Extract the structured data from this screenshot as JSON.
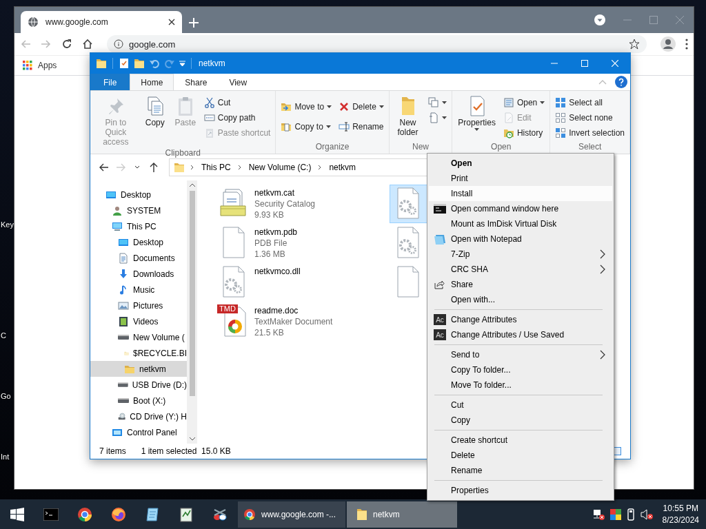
{
  "desktop": {
    "icon_labels": [
      "Key",
      "C",
      "Go",
      "Int"
    ]
  },
  "browser": {
    "tabs": [
      {
        "title": "www.google.com",
        "selected": true
      }
    ],
    "address": "google.com",
    "bookmarks": [
      {
        "label": "Apps",
        "kind": "apps"
      }
    ]
  },
  "explorer": {
    "title": "netkvm",
    "ribbon_tabs": [
      {
        "label": "File",
        "kind": "file",
        "selected": false
      },
      {
        "label": "Home",
        "kind": "tab",
        "selected": true
      },
      {
        "label": "Share",
        "kind": "tab",
        "selected": false
      },
      {
        "label": "View",
        "kind": "tab",
        "selected": false
      }
    ],
    "ribbon_groups": [
      {
        "label": "Clipboard",
        "columns": [
          [
            {
              "label": "Pin to Quick access",
              "kind": "large",
              "dropdown": false,
              "disabled": true
            }
          ],
          [
            {
              "label": "Copy",
              "kind": "large",
              "dropdown": false,
              "disabled": false
            }
          ],
          [
            {
              "label": "Paste",
              "kind": "large",
              "dropdown": false,
              "disabled": true
            }
          ],
          [
            {
              "label": "Cut",
              "kind": "small",
              "dropdown": false,
              "disabled": false
            },
            {
              "label": "Copy path",
              "kind": "small",
              "dropdown": false,
              "disabled": false
            },
            {
              "label": "Paste shortcut",
              "kind": "small",
              "dropdown": false,
              "disabled": true
            }
          ]
        ]
      },
      {
        "label": "Organize",
        "columns": [
          [
            {
              "label": "Move to",
              "kind": "small",
              "dropdown": true,
              "disabled": false
            },
            {
              "label": "Copy to",
              "kind": "small",
              "dropdown": true,
              "disabled": false
            }
          ],
          [
            {
              "label": "Delete",
              "kind": "small",
              "dropdown": true,
              "disabled": false
            },
            {
              "label": "Rename",
              "kind": "small",
              "dropdown": false,
              "disabled": false
            }
          ]
        ]
      },
      {
        "label": "New",
        "columns": [
          [
            {
              "label": "New folder",
              "kind": "large",
              "dropdown": false,
              "disabled": false
            }
          ],
          [
            {
              "kind": "small",
              "dropdown": true,
              "disabled": false
            },
            {
              "kind": "small",
              "dropdown": true,
              "disabled": false
            }
          ]
        ]
      },
      {
        "label": "Open",
        "columns": [
          [
            {
              "label": "Properties",
              "kind": "large",
              "dropdown": true,
              "disabled": false
            }
          ],
          [
            {
              "label": "Open",
              "kind": "small",
              "dropdown": true,
              "disabled": false
            },
            {
              "label": "Edit",
              "kind": "small",
              "dropdown": false,
              "disabled": true
            },
            {
              "label": "History",
              "kind": "small",
              "dropdown": false,
              "disabled": false
            }
          ]
        ]
      },
      {
        "label": "Select",
        "columns": [
          [
            {
              "label": "Select all",
              "kind": "small",
              "dropdown": false,
              "disabled": false
            },
            {
              "label": "Select none",
              "kind": "small",
              "dropdown": false,
              "disabled": false
            },
            {
              "label": "Invert selection",
              "kind": "small",
              "dropdown": false,
              "disabled": false
            }
          ]
        ]
      }
    ],
    "nav_buttons": [
      {
        "kind": "back",
        "disabled": false
      },
      {
        "kind": "forward",
        "disabled": true
      },
      {
        "kind": "recent",
        "disabled": false
      },
      {
        "kind": "up",
        "disabled": false
      }
    ],
    "breadcrumb": [
      "This PC",
      "New Volume (C:)",
      "netkvm"
    ],
    "nav_tree": [
      {
        "label": "Desktop",
        "selected": false,
        "children": [
          {
            "label": "SYSTEM",
            "selected": false
          },
          {
            "label": "This PC",
            "selected": false,
            "children": [
              {
                "label": "Desktop",
                "selected": false
              },
              {
                "label": "Documents",
                "selected": false
              },
              {
                "label": "Downloads",
                "selected": false
              },
              {
                "label": "Music",
                "selected": false
              },
              {
                "label": "Pictures",
                "selected": false
              },
              {
                "label": "Videos",
                "selected": false
              },
              {
                "label": "New Volume (",
                "selected": false,
                "children": [
                  {
                    "label": "$RECYCLE.BI",
                    "selected": false
                  },
                  {
                    "label": "netkvm",
                    "selected": true
                  }
                ]
              },
              {
                "label": "USB Drive (D:)",
                "selected": false
              },
              {
                "label": "Boot (X:)",
                "selected": false
              },
              {
                "label": "CD Drive (Y:) H",
                "selected": false
              }
            ]
          },
          {
            "label": "Control Panel",
            "selected": false
          }
        ]
      }
    ],
    "files": [
      {
        "name": "netkvm.cat",
        "type": "Security Catalog",
        "size": "9.93 KB",
        "selected": false
      },
      {
        "name": "netkvm.pdb",
        "type": "PDB File",
        "size": "1.36 MB",
        "selected": false
      },
      {
        "name": "netkvmco.dll",
        "selected": false
      },
      {
        "name": "readme.doc",
        "type": "TextMaker Document",
        "size": "21.5 KB",
        "badge": "TMD",
        "selected": false
      },
      {
        "selected": true
      },
      {
        "selected": false
      },
      {
        "selected": false
      }
    ],
    "status": {
      "items": "7 items",
      "selection": "1 item selected",
      "selection_size": "15.0 KB"
    }
  },
  "context_menu": {
    "items": [
      {
        "kind": "item",
        "label": "Open",
        "default": true,
        "hovered": false,
        "submenu": false
      },
      {
        "kind": "item",
        "label": "Print",
        "default": false,
        "hovered": false,
        "submenu": false
      },
      {
        "kind": "item",
        "label": "Install",
        "default": false,
        "hovered": true,
        "submenu": false
      },
      {
        "kind": "item",
        "label": "Open command window here",
        "default": false,
        "hovered": false,
        "submenu": false
      },
      {
        "kind": "item",
        "label": "Mount as ImDisk Virtual Disk",
        "default": false,
        "hovered": false,
        "submenu": false
      },
      {
        "kind": "item",
        "label": "Open with Notepad",
        "default": false,
        "hovered": false,
        "submenu": false
      },
      {
        "kind": "item",
        "label": "7-Zip",
        "default": false,
        "hovered": false,
        "submenu": true
      },
      {
        "kind": "item",
        "label": "CRC SHA",
        "default": false,
        "hovered": false,
        "submenu": true
      },
      {
        "kind": "item",
        "label": "Share",
        "default": false,
        "hovered": false,
        "submenu": false
      },
      {
        "kind": "item",
        "label": "Open with...",
        "default": false,
        "hovered": false,
        "submenu": false
      },
      {
        "kind": "separator"
      },
      {
        "kind": "item",
        "label": "Change Attributes",
        "icon_text": "Ac",
        "default": false,
        "hovered": false,
        "submenu": false
      },
      {
        "kind": "item",
        "label": "Change Attributes / Use Saved",
        "icon_text": "Ac",
        "default": false,
        "hovered": false,
        "submenu": false
      },
      {
        "kind": "separator"
      },
      {
        "kind": "item",
        "label": "Send to",
        "default": false,
        "hovered": false,
        "submenu": true
      },
      {
        "kind": "item",
        "label": "Copy To folder...",
        "default": false,
        "hovered": false,
        "submenu": false
      },
      {
        "kind": "item",
        "label": "Move To folder...",
        "default": false,
        "hovered": false,
        "submenu": false
      },
      {
        "kind": "separator"
      },
      {
        "kind": "item",
        "label": "Cut",
        "default": false,
        "hovered": false,
        "submenu": false
      },
      {
        "kind": "item",
        "label": "Copy",
        "default": false,
        "hovered": false,
        "submenu": false
      },
      {
        "kind": "separator"
      },
      {
        "kind": "item",
        "label": "Create shortcut",
        "default": false,
        "hovered": false,
        "submenu": false
      },
      {
        "kind": "item",
        "label": "Delete",
        "default": false,
        "hovered": false,
        "submenu": false
      },
      {
        "kind": "item",
        "label": "Rename",
        "default": false,
        "hovered": false,
        "submenu": false
      },
      {
        "kind": "separator"
      },
      {
        "kind": "item",
        "label": "Properties",
        "default": false,
        "hovered": false,
        "submenu": false
      }
    ]
  },
  "taskbar": {
    "tasks": [
      {
        "label": "www.google.com -...",
        "kind": "browser",
        "active": false
      },
      {
        "label": "netkvm",
        "kind": "folder",
        "active": true
      }
    ],
    "clock": {
      "time": "10:55 PM",
      "date": "8/23/2024"
    }
  }
}
